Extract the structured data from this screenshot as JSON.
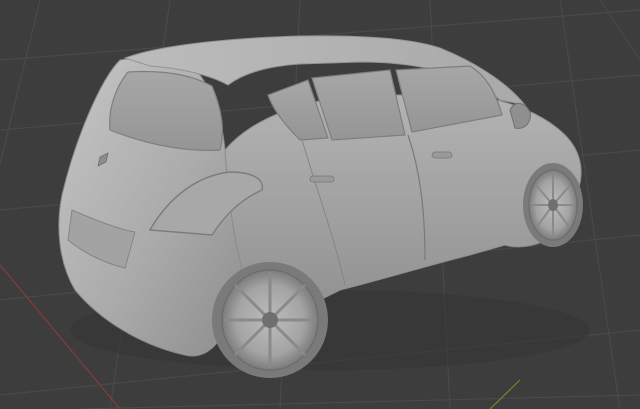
{
  "viewport": {
    "background": "#3d3d3d",
    "grid_color": "#4a4a4a",
    "x_axis_color": "#8b3a3a",
    "y_axis_color": "#6b8a2a",
    "shading": "solid",
    "model_color": "#b8b8b8"
  },
  "model": {
    "icons": [
      "car-model-icon"
    ]
  }
}
